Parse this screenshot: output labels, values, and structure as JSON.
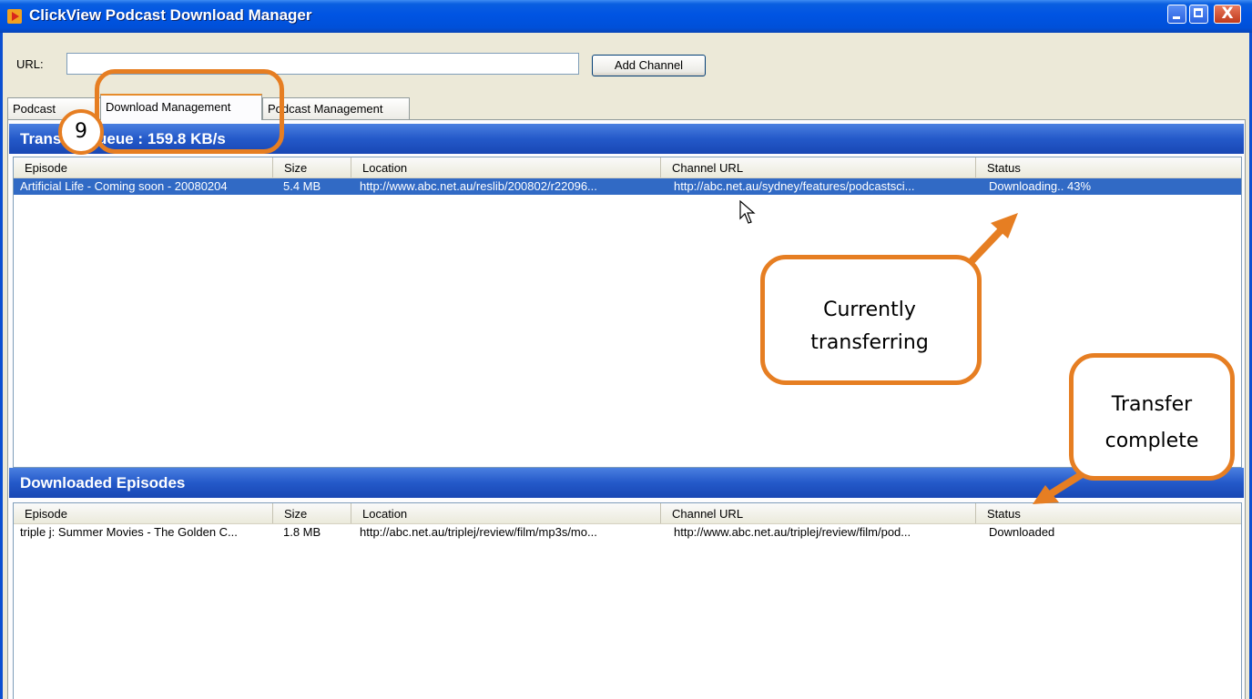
{
  "window": {
    "title": "ClickView Podcast Download Manager",
    "close_glyph": "X"
  },
  "url_bar": {
    "label": "URL:",
    "value": "",
    "add_button": "Add Channel"
  },
  "tabs": [
    {
      "label": "Podcast Channels",
      "visible_label": "Podcast",
      "selected": false
    },
    {
      "label": "Download Management",
      "selected": true
    },
    {
      "label": "Podcast Management",
      "selected": false
    }
  ],
  "transfer_queue": {
    "title": "Transfer Queue : 159.8 KB/s",
    "columns": [
      "Episode",
      "Size",
      "Location",
      "Channel URL",
      "Status"
    ],
    "rows": [
      {
        "episode": "Artificial Life - Coming soon - 20080204",
        "size": "5.4 MB",
        "location": "http://www.abc.net.au/reslib/200802/r22096...",
        "channel_url": "http://abc.net.au/sydney/features/podcastsci...",
        "status": "Downloading.. 43%",
        "selected": true
      }
    ]
  },
  "downloaded": {
    "title": "Downloaded Episodes",
    "columns": [
      "Episode",
      "Size",
      "Location",
      "Channel URL",
      "Status"
    ],
    "rows": [
      {
        "episode": "triple j: Summer Movies - The Golden C...",
        "size": "1.8 MB",
        "location": "http://abc.net.au/triplej/review/film/mp3s/mo...",
        "channel_url": "http://www.abc.net.au/triplej/review/film/pod...",
        "status": "Downloaded",
        "selected": false
      }
    ]
  },
  "annotations": {
    "step_number": "9",
    "callout_current": "Currently transferring",
    "callout_complete": "Transfer complete",
    "accent_color": "#e67e22"
  },
  "colors": {
    "titlebar": "#0054e3",
    "section_header": "#2459c9",
    "selection": "#316ac5"
  }
}
